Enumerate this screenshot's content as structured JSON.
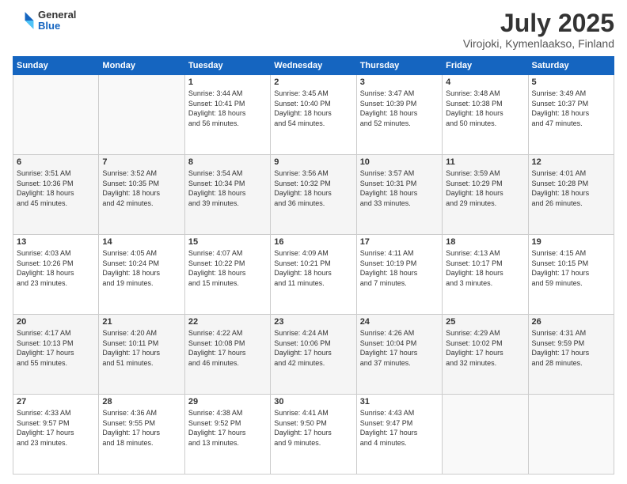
{
  "logo": {
    "general": "General",
    "blue": "Blue"
  },
  "title": {
    "month": "July 2025",
    "location": "Virojoki, Kymenlaakso, Finland"
  },
  "days_header": [
    "Sunday",
    "Monday",
    "Tuesday",
    "Wednesday",
    "Thursday",
    "Friday",
    "Saturday"
  ],
  "weeks": [
    [
      {
        "day": "",
        "info": ""
      },
      {
        "day": "",
        "info": ""
      },
      {
        "day": "1",
        "info": "Sunrise: 3:44 AM\nSunset: 10:41 PM\nDaylight: 18 hours\nand 56 minutes."
      },
      {
        "day": "2",
        "info": "Sunrise: 3:45 AM\nSunset: 10:40 PM\nDaylight: 18 hours\nand 54 minutes."
      },
      {
        "day": "3",
        "info": "Sunrise: 3:47 AM\nSunset: 10:39 PM\nDaylight: 18 hours\nand 52 minutes."
      },
      {
        "day": "4",
        "info": "Sunrise: 3:48 AM\nSunset: 10:38 PM\nDaylight: 18 hours\nand 50 minutes."
      },
      {
        "day": "5",
        "info": "Sunrise: 3:49 AM\nSunset: 10:37 PM\nDaylight: 18 hours\nand 47 minutes."
      }
    ],
    [
      {
        "day": "6",
        "info": "Sunrise: 3:51 AM\nSunset: 10:36 PM\nDaylight: 18 hours\nand 45 minutes."
      },
      {
        "day": "7",
        "info": "Sunrise: 3:52 AM\nSunset: 10:35 PM\nDaylight: 18 hours\nand 42 minutes."
      },
      {
        "day": "8",
        "info": "Sunrise: 3:54 AM\nSunset: 10:34 PM\nDaylight: 18 hours\nand 39 minutes."
      },
      {
        "day": "9",
        "info": "Sunrise: 3:56 AM\nSunset: 10:32 PM\nDaylight: 18 hours\nand 36 minutes."
      },
      {
        "day": "10",
        "info": "Sunrise: 3:57 AM\nSunset: 10:31 PM\nDaylight: 18 hours\nand 33 minutes."
      },
      {
        "day": "11",
        "info": "Sunrise: 3:59 AM\nSunset: 10:29 PM\nDaylight: 18 hours\nand 29 minutes."
      },
      {
        "day": "12",
        "info": "Sunrise: 4:01 AM\nSunset: 10:28 PM\nDaylight: 18 hours\nand 26 minutes."
      }
    ],
    [
      {
        "day": "13",
        "info": "Sunrise: 4:03 AM\nSunset: 10:26 PM\nDaylight: 18 hours\nand 23 minutes."
      },
      {
        "day": "14",
        "info": "Sunrise: 4:05 AM\nSunset: 10:24 PM\nDaylight: 18 hours\nand 19 minutes."
      },
      {
        "day": "15",
        "info": "Sunrise: 4:07 AM\nSunset: 10:22 PM\nDaylight: 18 hours\nand 15 minutes."
      },
      {
        "day": "16",
        "info": "Sunrise: 4:09 AM\nSunset: 10:21 PM\nDaylight: 18 hours\nand 11 minutes."
      },
      {
        "day": "17",
        "info": "Sunrise: 4:11 AM\nSunset: 10:19 PM\nDaylight: 18 hours\nand 7 minutes."
      },
      {
        "day": "18",
        "info": "Sunrise: 4:13 AM\nSunset: 10:17 PM\nDaylight: 18 hours\nand 3 minutes."
      },
      {
        "day": "19",
        "info": "Sunrise: 4:15 AM\nSunset: 10:15 PM\nDaylight: 17 hours\nand 59 minutes."
      }
    ],
    [
      {
        "day": "20",
        "info": "Sunrise: 4:17 AM\nSunset: 10:13 PM\nDaylight: 17 hours\nand 55 minutes."
      },
      {
        "day": "21",
        "info": "Sunrise: 4:20 AM\nSunset: 10:11 PM\nDaylight: 17 hours\nand 51 minutes."
      },
      {
        "day": "22",
        "info": "Sunrise: 4:22 AM\nSunset: 10:08 PM\nDaylight: 17 hours\nand 46 minutes."
      },
      {
        "day": "23",
        "info": "Sunrise: 4:24 AM\nSunset: 10:06 PM\nDaylight: 17 hours\nand 42 minutes."
      },
      {
        "day": "24",
        "info": "Sunrise: 4:26 AM\nSunset: 10:04 PM\nDaylight: 17 hours\nand 37 minutes."
      },
      {
        "day": "25",
        "info": "Sunrise: 4:29 AM\nSunset: 10:02 PM\nDaylight: 17 hours\nand 32 minutes."
      },
      {
        "day": "26",
        "info": "Sunrise: 4:31 AM\nSunset: 9:59 PM\nDaylight: 17 hours\nand 28 minutes."
      }
    ],
    [
      {
        "day": "27",
        "info": "Sunrise: 4:33 AM\nSunset: 9:57 PM\nDaylight: 17 hours\nand 23 minutes."
      },
      {
        "day": "28",
        "info": "Sunrise: 4:36 AM\nSunset: 9:55 PM\nDaylight: 17 hours\nand 18 minutes."
      },
      {
        "day": "29",
        "info": "Sunrise: 4:38 AM\nSunset: 9:52 PM\nDaylight: 17 hours\nand 13 minutes."
      },
      {
        "day": "30",
        "info": "Sunrise: 4:41 AM\nSunset: 9:50 PM\nDaylight: 17 hours\nand 9 minutes."
      },
      {
        "day": "31",
        "info": "Sunrise: 4:43 AM\nSunset: 9:47 PM\nDaylight: 17 hours\nand 4 minutes."
      },
      {
        "day": "",
        "info": ""
      },
      {
        "day": "",
        "info": ""
      }
    ]
  ]
}
